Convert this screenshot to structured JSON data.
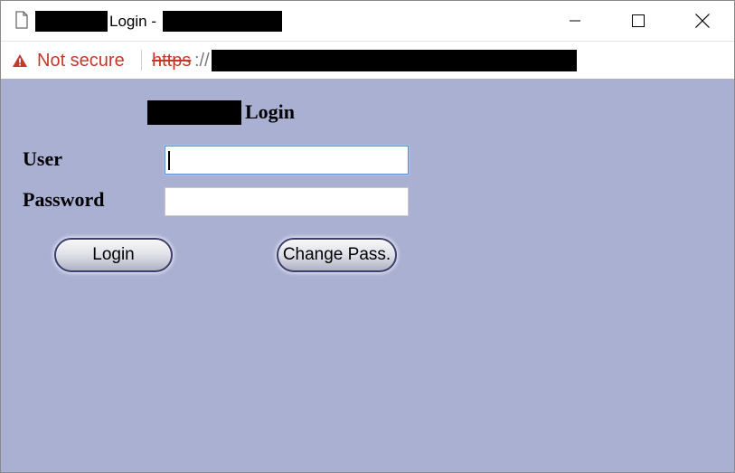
{
  "window": {
    "title_suffix": "Login -",
    "controls": {
      "minimize_icon": "minimize-icon",
      "maximize_icon": "maximize-icon",
      "close_icon": "close-icon"
    }
  },
  "addressbar": {
    "security_icon": "warning-triangle-icon",
    "security_text": "Not secure",
    "url_scheme": "https",
    "url_separator": "://"
  },
  "login_form": {
    "heading": "Login",
    "user_label": "User",
    "user_value": "",
    "password_label": "Password",
    "password_value": "",
    "login_button": "Login",
    "change_pass_button": "Change Pass."
  },
  "colors": {
    "content_background": "#aab0d2",
    "warning_red": "#c5392b",
    "focus_border": "#5b8ed9",
    "button_border": "#3d3f6c"
  }
}
